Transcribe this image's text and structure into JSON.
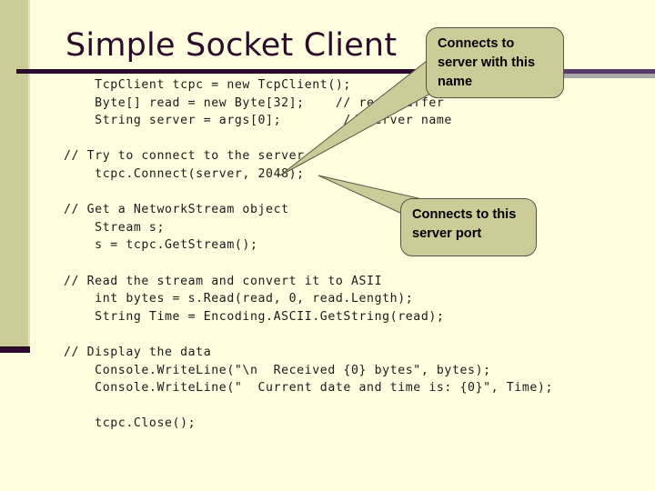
{
  "slide": {
    "title": "Simple Socket Client",
    "background_color": "#FFFFE0",
    "accent_color": "#CCCC99",
    "title_color": "#2B0A2B"
  },
  "code": {
    "lines": [
      "    TcpClient tcpc = new TcpClient();",
      "    Byte[] read = new Byte[32];    // read buffer",
      "    String server = args[0];        // server name",
      "",
      "// Try to connect to the server",
      "    tcpc.Connect(server, 2048);",
      "",
      "// Get a NetworkStream object",
      "    Stream s;",
      "    s = tcpc.GetStream();",
      "",
      "// Read the stream and convert it to ASII",
      "    int bytes = s.Read(read, 0, read.Length);",
      "    String Time = Encoding.ASCII.GetString(read);",
      "",
      "// Display the data",
      "    Console.WriteLine(\"\\n  Received {0} bytes\", bytes);",
      "    Console.WriteLine(\"  Current date and time is: {0}\", Time);",
      "",
      "    tcpc.Close();"
    ]
  },
  "callouts": [
    {
      "id": "server-name",
      "text": "Connects to server with this name"
    },
    {
      "id": "server-port",
      "text": "Connects to this server port"
    }
  ]
}
